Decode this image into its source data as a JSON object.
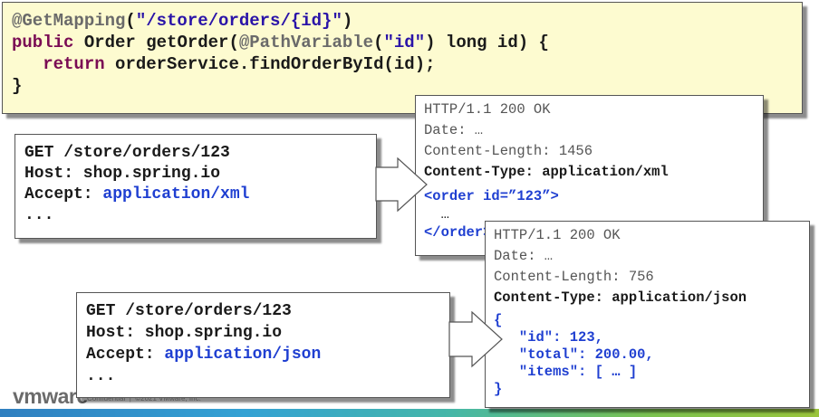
{
  "controller_code": {
    "line1": {
      "mapping": "@GetMapping",
      "open": "(",
      "path": "\"/store/orders/{id}\"",
      "close": ")"
    },
    "line2": {
      "public": "public",
      "sig1": " Order getOrder(",
      "anno": "@PathVariable",
      "p_open": "(",
      "arg": "\"id\"",
      "sig2": ") long id) {"
    },
    "line3": {
      "indent": "   ",
      "ret": "return",
      "call": " orderService.findOrderById(id);"
    },
    "line4": "}"
  },
  "xml_request": {
    "line1": "GET /store/orders/123",
    "line2": "Host: shop.spring.io",
    "line3_label": "Accept: ",
    "line3_value": "application/xml",
    "line4": "..."
  },
  "json_request": {
    "line1": "GET /store/orders/123",
    "line2": "Host: shop.spring.io",
    "line3_label": "Accept: ",
    "line3_value": "application/json",
    "line4": "..."
  },
  "xml_response": {
    "status": "HTTP/1.1 200 OK",
    "date": "Date: …",
    "length": "Content-Length: 1456",
    "type": "Content-Type: application/xml",
    "body1": "<order id=”123”>",
    "body2": "  …",
    "body3": "</order>"
  },
  "json_response": {
    "status": "HTTP/1.1 200 OK",
    "date": "Date: …",
    "length": "Content-Length: 756",
    "type": "Content-Type: application/json",
    "body1": "{",
    "body2": "   \"id\": 123,",
    "body3": "   \"total\": 200.00,",
    "body4": "   \"items\": [ … ]",
    "body5": "}"
  },
  "footer": {
    "logo": "vmware",
    "legal": "Confidential  |  ©2021 VMware, Inc."
  },
  "colors": {
    "code_bg": "#fdfbd0",
    "keyword": "#7a0c54",
    "string": "#2a14a8",
    "blue": "#1f3fd1"
  }
}
